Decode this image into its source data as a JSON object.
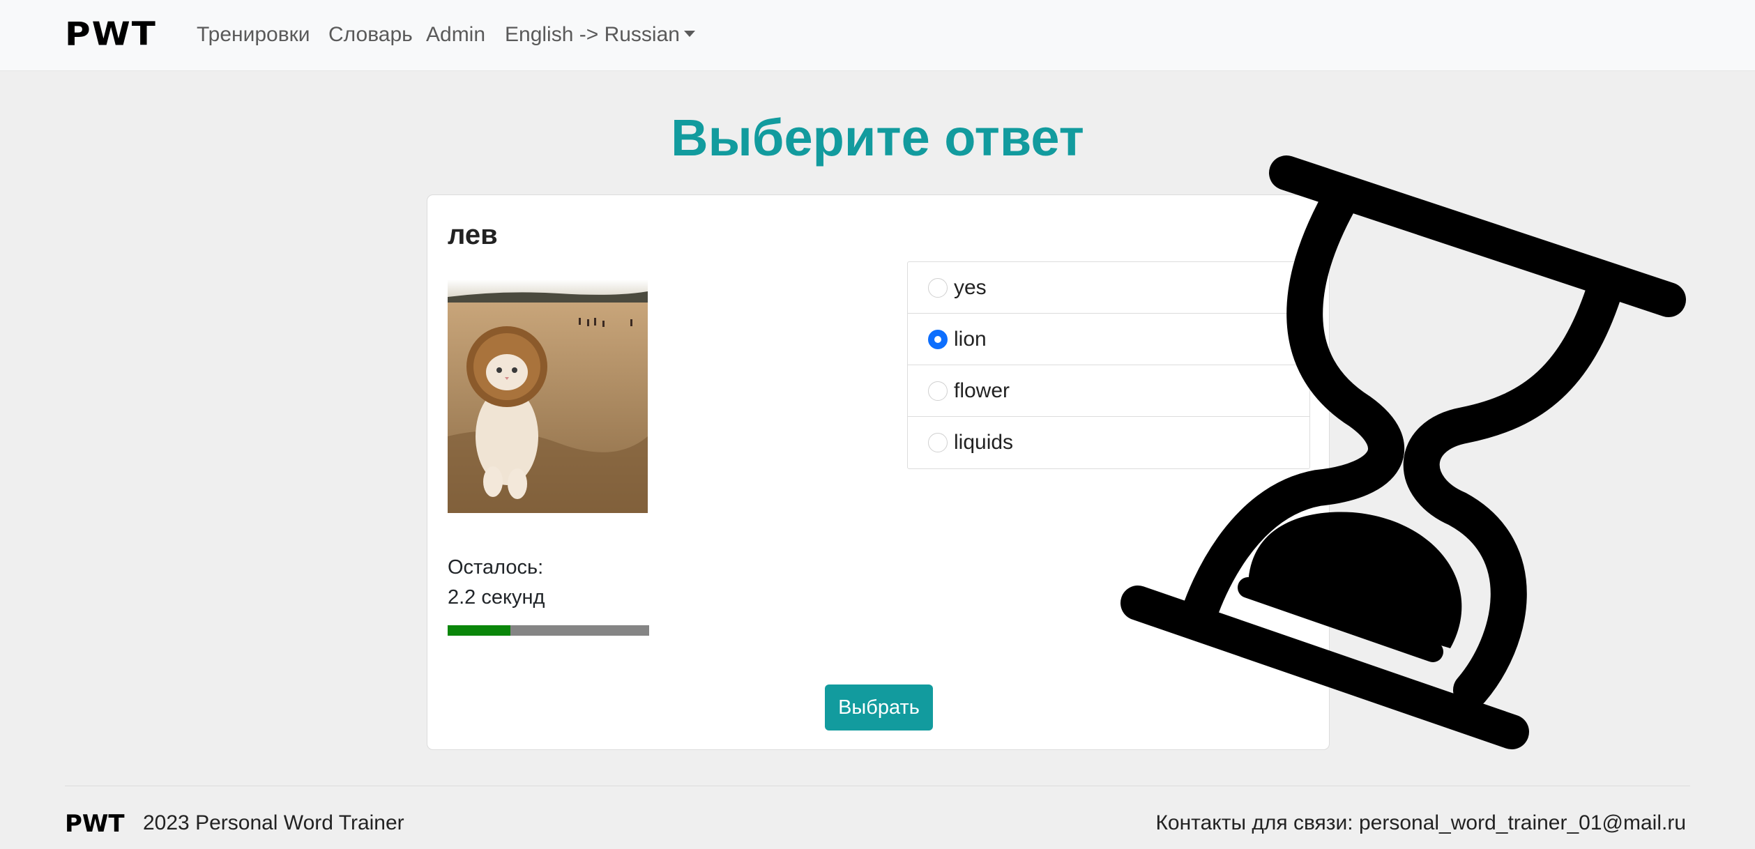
{
  "navbar": {
    "brand": "PWT",
    "items": [
      {
        "label": "Тренировки"
      },
      {
        "label": "Словарь"
      },
      {
        "label": "Admin"
      },
      {
        "label": "English -> Russian"
      }
    ]
  },
  "page": {
    "title": "Выберите ответ"
  },
  "quiz": {
    "word": "лев",
    "remain_label": "Осталось:",
    "remain_value": "2.2 секунд",
    "progress_fraction": 0.31,
    "options": [
      {
        "label": "yes",
        "checked": false
      },
      {
        "label": "lion",
        "checked": true
      },
      {
        "label": "flower",
        "checked": false
      },
      {
        "label": "liquids",
        "checked": false
      }
    ],
    "submit_label": "Выбрать"
  },
  "footer": {
    "brand": "PWT",
    "text": "2023 Personal Word Trainer",
    "contact": "Контакты для связи: personal_word_trainer_01@mail.ru"
  },
  "colors": {
    "accent": "#129b9e",
    "progress_fill": "#0a860a",
    "progress_track": "#858585",
    "radio_checked": "#0d6efd"
  }
}
